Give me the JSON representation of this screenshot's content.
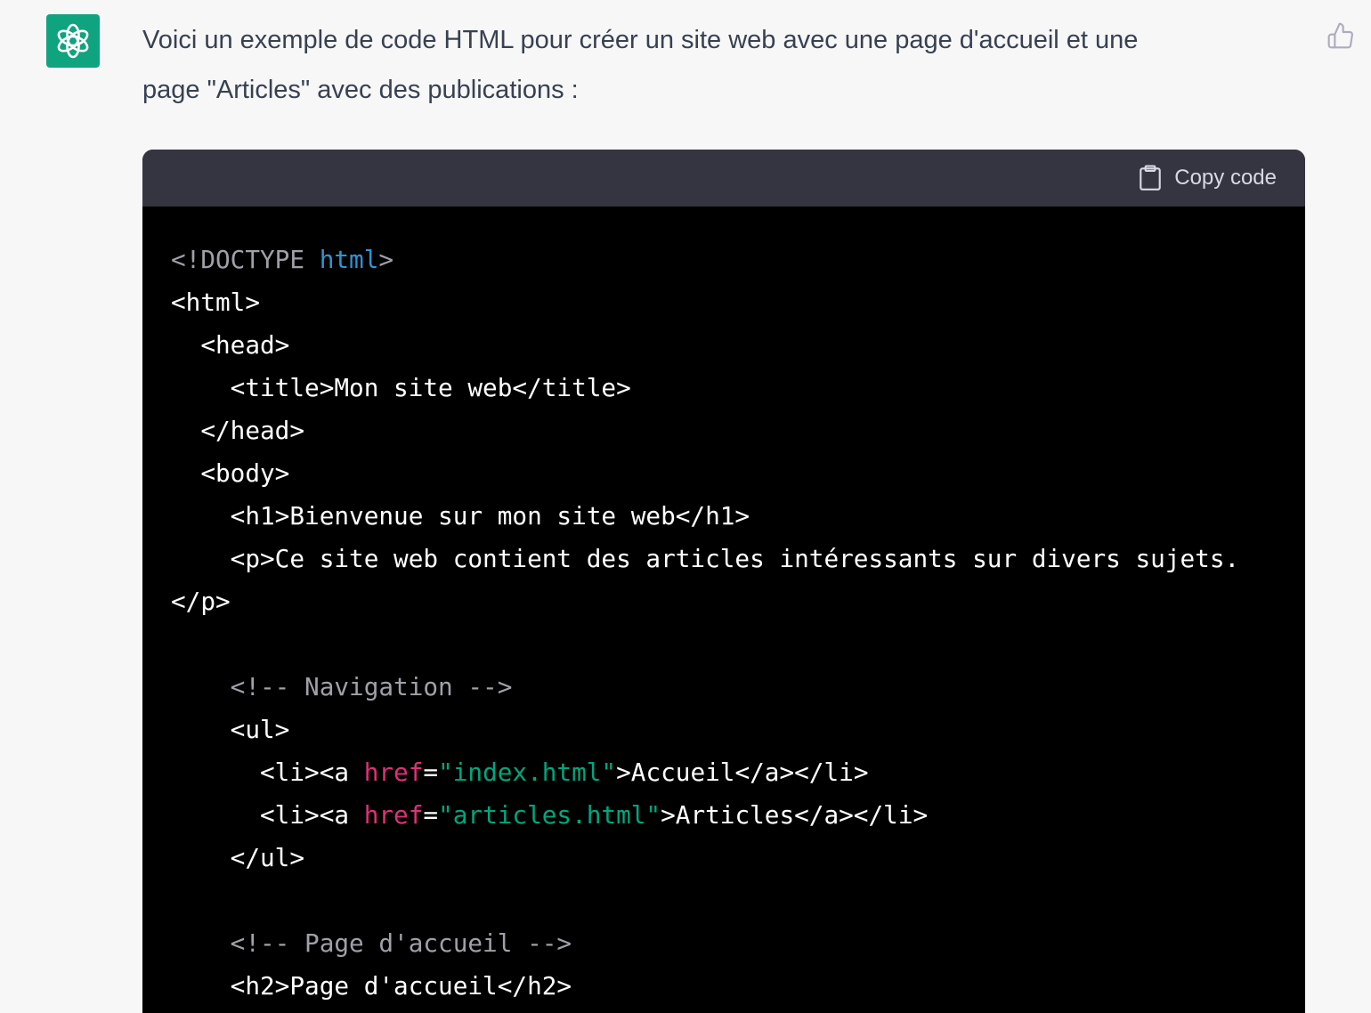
{
  "message": {
    "intro_line1": "Voici un exemple de code HTML pour créer un site web avec une page d'accueil et une",
    "intro_line2": "page \"Articles\" avec des publications :"
  },
  "icons": {
    "avatar": "openai-logo-icon",
    "thumb": "thumbs-up-icon",
    "copy": "clipboard-icon"
  },
  "colors": {
    "avatar_bg": "#10a37f",
    "code_header_bg": "#343541",
    "code_bg": "#000000",
    "tag_name_blue": "#2e95d3",
    "attr_pink": "#df3079",
    "string_green": "#00a67d",
    "comment_gray": "#a0a0a8"
  },
  "code_block": {
    "copy_label": "Copy code",
    "lines": [
      {
        "tokens": [
          {
            "t": "<!DOCTYPE ",
            "c": "gray"
          },
          {
            "t": "html",
            "c": "blue"
          },
          {
            "t": ">",
            "c": "gray"
          }
        ]
      },
      {
        "tokens": [
          {
            "t": "<html>",
            "c": "white"
          }
        ]
      },
      {
        "tokens": [
          {
            "t": "  <head>",
            "c": "white"
          }
        ]
      },
      {
        "tokens": [
          {
            "t": "    <title>Mon site web</title>",
            "c": "white"
          }
        ]
      },
      {
        "tokens": [
          {
            "t": "  </head>",
            "c": "white"
          }
        ]
      },
      {
        "tokens": [
          {
            "t": "  <body>",
            "c": "white"
          }
        ]
      },
      {
        "tokens": [
          {
            "t": "    <h1>Bienvenue sur mon site web</h1>",
            "c": "white"
          }
        ]
      },
      {
        "tokens": [
          {
            "t": "    <p>Ce site web contient des articles intéressants sur divers sujets.",
            "c": "white"
          }
        ]
      },
      {
        "tokens": [
          {
            "t": "</p>",
            "c": "white"
          }
        ]
      },
      {
        "tokens": []
      },
      {
        "tokens": [
          {
            "t": "    <!-- Navigation -->",
            "c": "gray"
          }
        ]
      },
      {
        "tokens": [
          {
            "t": "    <ul>",
            "c": "white"
          }
        ]
      },
      {
        "tokens": [
          {
            "t": "      <li><a ",
            "c": "white"
          },
          {
            "t": "href",
            "c": "pink"
          },
          {
            "t": "=",
            "c": "white"
          },
          {
            "t": "\"index.html\"",
            "c": "green"
          },
          {
            "t": ">Accueil</a></li>",
            "c": "white"
          }
        ]
      },
      {
        "tokens": [
          {
            "t": "      <li><a ",
            "c": "white"
          },
          {
            "t": "href",
            "c": "pink"
          },
          {
            "t": "=",
            "c": "white"
          },
          {
            "t": "\"articles.html\"",
            "c": "green"
          },
          {
            "t": ">Articles</a></li>",
            "c": "white"
          }
        ]
      },
      {
        "tokens": [
          {
            "t": "    </ul>",
            "c": "white"
          }
        ]
      },
      {
        "tokens": []
      },
      {
        "tokens": [
          {
            "t": "    <!-- Page d'accueil -->",
            "c": "gray"
          }
        ]
      },
      {
        "tokens": [
          {
            "t": "    <h2>Page d'accueil</h2>",
            "c": "white"
          }
        ]
      }
    ]
  }
}
